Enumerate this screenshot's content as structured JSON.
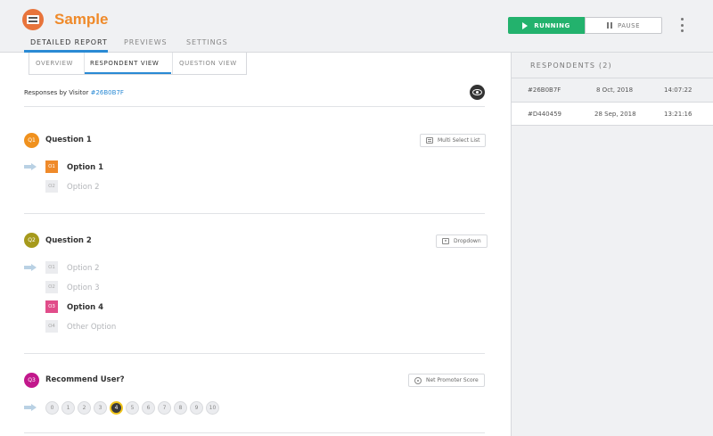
{
  "app": {
    "title": "Sample"
  },
  "main_tabs": [
    {
      "label": "DETAILED REPORT"
    },
    {
      "label": "PREVIEWS"
    },
    {
      "label": "SETTINGS"
    }
  ],
  "controls": {
    "running_label": "RUNNING",
    "pause_label": "PAUSE"
  },
  "sub_tabs": [
    {
      "label": "OVERVIEW"
    },
    {
      "label": "RESPONDENT VIEW"
    },
    {
      "label": "QUESTION VIEW"
    }
  ],
  "visitor": {
    "prefix": "Responses by Visitor ",
    "id": "#26B0B7F"
  },
  "questions": [
    {
      "badge": "Q1",
      "badge_color": "#f0911e",
      "title": "Question 1",
      "type_label": "Multi Select List",
      "type_icon": "list-icon",
      "options": [
        {
          "code": "O1",
          "label": "Option 1",
          "selected": true
        },
        {
          "code": "O2",
          "label": "Option 2",
          "selected": false
        }
      ]
    },
    {
      "badge": "Q2",
      "badge_color": "#a69a1c",
      "title": "Question 2",
      "type_label": "Dropdown",
      "type_icon": "dropdown-icon",
      "options": [
        {
          "code": "O1",
          "label": "Option 2",
          "selected": false
        },
        {
          "code": "O2",
          "label": "Option 3",
          "selected": false
        },
        {
          "code": "O3",
          "label": "Option 4",
          "selected": true
        },
        {
          "code": "O4",
          "label": "Other Option",
          "selected": false
        }
      ]
    },
    {
      "badge": "Q3",
      "badge_color": "#c2188c",
      "title": "Recommend User?",
      "type_label": "Net Promoter Score",
      "type_icon": "nps-icon",
      "scale": [
        "0",
        "1",
        "2",
        "3",
        "4",
        "5",
        "6",
        "7",
        "8",
        "9",
        "10"
      ],
      "selected_value": "4"
    }
  ],
  "respondents": {
    "header": "RESPONDENTS (2)",
    "rows": [
      {
        "id": "#26B0B7F",
        "date": "8 Oct, 2018",
        "time": "14:07:22",
        "selected": false
      },
      {
        "id": "#D440459",
        "date": "28 Sep, 2018",
        "time": "13:21:16",
        "selected": true
      }
    ]
  },
  "colors": {
    "accent": "#2a8ad4",
    "running": "#23b26d",
    "brand": "#ef8a2a"
  }
}
